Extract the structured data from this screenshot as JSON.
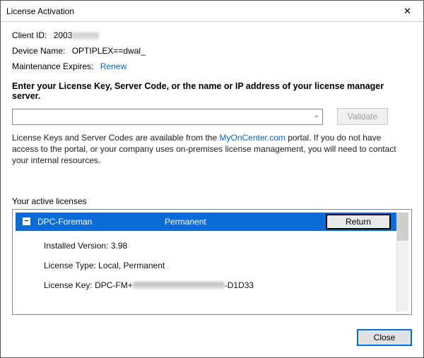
{
  "window": {
    "title": "License Activation",
    "close_glyph": "✕"
  },
  "client": {
    "id_label": "Client ID:",
    "id_value_visible": "2003",
    "device_label": "Device Name:",
    "device_value": "OPTIPLEX==dwal_",
    "maint_label": "Maintenance Expires:",
    "renew_link": "Renew"
  },
  "instruction": "Enter your License Key, Server Code, or the name or IP address of your license manager server.",
  "validate_label": "Validate",
  "help_pre": "License Keys and Server Codes are available from the ",
  "help_link": "MyOnCenter.com",
  "help_post": " portal.  If you do not have access to the portal, or your company uses on-premises license management, you will need to contact your internal resources.",
  "active_label": "Your active licenses",
  "selected": {
    "name": "DPC-Foreman",
    "status": "Permanent",
    "return_label": "Return"
  },
  "details": {
    "installed_label": "Installed Version:",
    "installed_value": "3.98",
    "type_label": "License Type:",
    "type_value": "Local, Permanent",
    "key_label": "License Key:",
    "key_prefix": "DPC-FM+",
    "key_suffix": "-D1D33"
  },
  "close_label": "Close"
}
